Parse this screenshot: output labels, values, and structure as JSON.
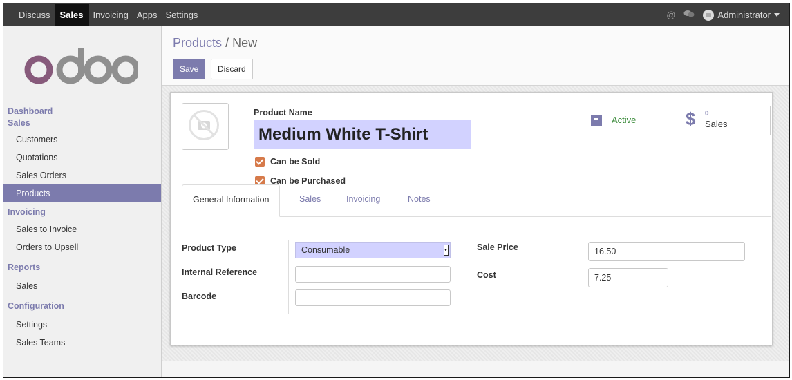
{
  "topbar": {
    "menu": [
      "Discuss",
      "Sales",
      "Invoicing",
      "Apps",
      "Settings"
    ],
    "active_menu": "Sales",
    "user": "Administrator",
    "icons": [
      "at-sign-icon",
      "chat-bubbles-icon",
      "user-avatar-icon"
    ]
  },
  "sidebar": {
    "logo": "odoo",
    "dashboard": "Dashboard",
    "sales_section": "Sales",
    "sales_items": [
      "Customers",
      "Quotations",
      "Sales Orders",
      "Products"
    ],
    "active_item": "Products",
    "invoicing_section": "Invoicing",
    "invoicing_items": [
      "Sales to Invoice",
      "Orders to Upsell"
    ],
    "reports_section": "Reports",
    "reports_items": [
      "Sales"
    ],
    "config_section": "Configuration",
    "config_items": [
      "Settings",
      "Sales Teams"
    ]
  },
  "control_panel": {
    "breadcrumb_parent": "Products",
    "breadcrumb_sep": "/",
    "breadcrumb_current": "New",
    "save_label": "Save",
    "discard_label": "Discard"
  },
  "form": {
    "product_name_label": "Product Name",
    "product_name_value": "Medium White T-Shirt",
    "can_be_sold_label": "Can be Sold",
    "can_be_sold": true,
    "can_be_purchased_label": "Can be Purchased",
    "can_be_purchased": true,
    "active_label": "Active",
    "sales_count": "0",
    "sales_label": "Sales",
    "tabs": [
      "General Information",
      "Sales",
      "Invoicing",
      "Notes"
    ],
    "active_tab": "General Information",
    "product_type_label": "Product Type",
    "product_type_value": "Consumable",
    "internal_ref_label": "Internal Reference",
    "internal_ref_value": "",
    "barcode_label": "Barcode",
    "barcode_value": "",
    "sale_price_label": "Sale Price",
    "sale_price_value": "16.50",
    "cost_label": "Cost",
    "cost_value": "7.25"
  },
  "colors": {
    "brand": "#7c7bad",
    "topbar": "#3d3d3d",
    "checkbox": "#d67a4a",
    "active_green": "#3a8a3a",
    "required_field": "#d2d2ff"
  }
}
